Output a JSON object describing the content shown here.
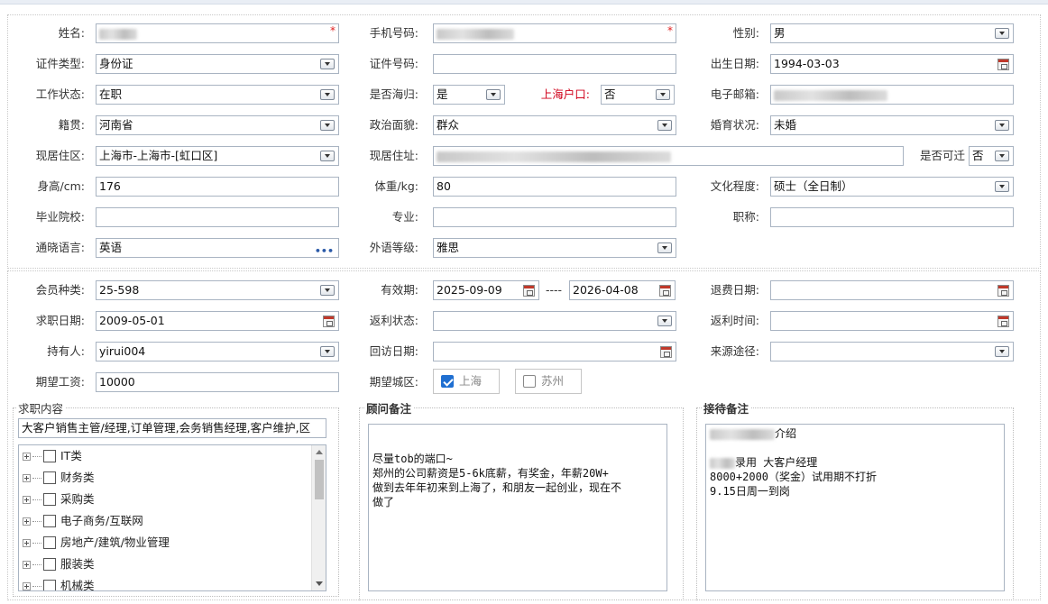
{
  "basic": {
    "name": {
      "label": "姓名:",
      "required": "*"
    },
    "phone": {
      "label": "手机号码:",
      "required": "*"
    },
    "gender": {
      "label": "性别:",
      "value": "男"
    },
    "id_type": {
      "label": "证件类型:",
      "value": "身份证"
    },
    "id_number": {
      "label": "证件号码:",
      "value": ""
    },
    "birth": {
      "label": "出生日期:",
      "value": "1994-03-03"
    },
    "work_status": {
      "label": "工作状态:",
      "value": "在职"
    },
    "overseas": {
      "label": "是否海归:",
      "value": "是"
    },
    "shanghai_hukou": {
      "label": "上海户口:",
      "value": "否"
    },
    "email": {
      "label": "电子邮箱:"
    },
    "native": {
      "label": "籍贯:",
      "value": "河南省"
    },
    "political": {
      "label": "政治面貌:",
      "value": "群众"
    },
    "marital": {
      "label": "婚育状况:",
      "value": "未婚"
    },
    "residence_area": {
      "label": "现居住区:",
      "value": "上海市-上海市-[虹口区]"
    },
    "address": {
      "label": "现居住址:"
    },
    "relocate": {
      "label": "是否可迁",
      "value": "否"
    },
    "height": {
      "label": "身高/cm:",
      "value": "176"
    },
    "weight": {
      "label": "体重/kg:",
      "value": "80"
    },
    "education": {
      "label": "文化程度:",
      "value": "硕士（全日制）"
    },
    "school": {
      "label": "毕业院校:",
      "value": ""
    },
    "major": {
      "label": "专业:",
      "value": ""
    },
    "title": {
      "label": "职称:",
      "value": ""
    },
    "languages": {
      "label": "通晓语言:",
      "value": "英语",
      "more": "•••"
    },
    "lang_level": {
      "label": "外语等级:",
      "value": "雅思"
    }
  },
  "member": {
    "type": {
      "label": "会员种类:",
      "value": "25-598"
    },
    "validity": {
      "label": "有效期:",
      "from": "2025-09-09",
      "sep": "----",
      "to": "2026-04-08"
    },
    "refund_date": {
      "label": "退费日期:",
      "value": ""
    },
    "job_date": {
      "label": "求职日期:",
      "value": "2009-05-01"
    },
    "rebate_status": {
      "label": "返利状态:",
      "value": ""
    },
    "rebate_time": {
      "label": "返利时间:",
      "value": ""
    },
    "holder": {
      "label": "持有人:",
      "value": "yirui004"
    },
    "revisit_date": {
      "label": "回访日期:",
      "value": ""
    },
    "source": {
      "label": "来源途径:",
      "value": ""
    },
    "salary": {
      "label": "期望工资:",
      "value": "10000"
    },
    "city": {
      "label": "期望城区:",
      "options": [
        {
          "label": "上海",
          "checked": true
        },
        {
          "label": "苏州",
          "checked": false
        }
      ]
    }
  },
  "job_content": {
    "title": "求职内容",
    "summary": "大客户销售主管/经理,订单管理,会务销售经理,客户维护,区",
    "categories": [
      "IT类",
      "财务类",
      "采购类",
      "电子商务/互联网",
      "房地产/建筑/物业管理",
      "服装类",
      "机械类"
    ]
  },
  "consultant_notes": {
    "title": "顾问备注",
    "lines": [
      "",
      "尽量tob的端口~",
      "郑州的公司薪资是5-6k底薪，有奖金，年薪20W+",
      "做到去年年初来到上海了，和朋友一起创业，现在不",
      "做了"
    ]
  },
  "reception_notes": {
    "title": "接待备注",
    "line1_suffix": "介绍",
    "line3_suffix": "录用 大客户经理",
    "line4": "8000+2000（奖金）试用期不打折",
    "line5": "9.15日周一到岗"
  }
}
